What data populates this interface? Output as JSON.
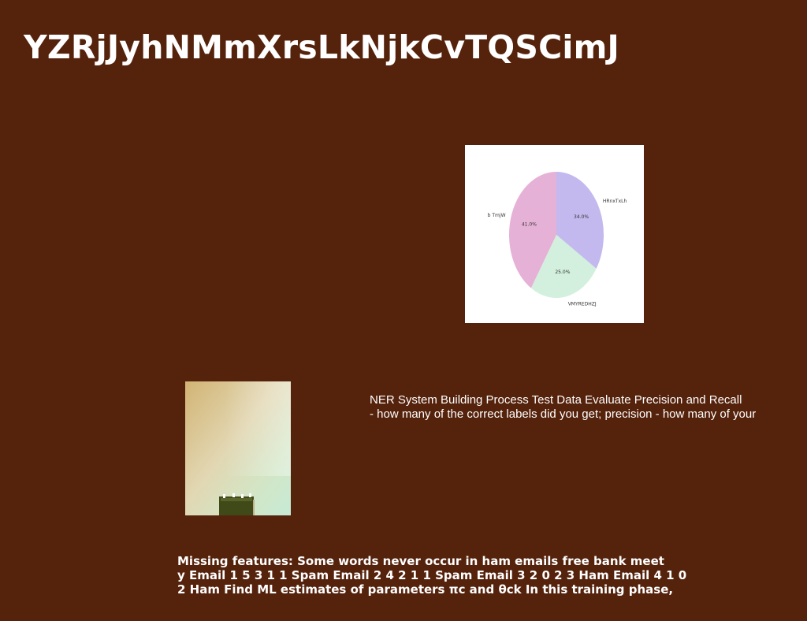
{
  "page": {
    "title": "YZRjJyhNMmXrsLkNjkCvTQSCimJ",
    "background_color": "#55220c"
  },
  "chart_data": {
    "type": "pie",
    "title": "",
    "slices": [
      {
        "label": "HRnxTxLh",
        "value": 34.0,
        "value_label": "34.0%",
        "color": "#c3b9ee"
      },
      {
        "label": "VMYREDHZJ",
        "value": 25.0,
        "value_label": "25.0%",
        "color": "#d2f0dd"
      },
      {
        "label": "b TmjW",
        "value": 41.0,
        "value_label": "41.0%",
        "color": "#e6b1d6"
      }
    ]
  },
  "photo": {
    "description_icon": "photo-image"
  },
  "side_text": {
    "line1": "NER System Building Process Test Data Evaluate Precision and Recall",
    "line2": "- how many of the correct labels did you get; precision - how many of your"
  },
  "bottom_text": {
    "line1": "Missing features: Some words never occur in ham emails free bank meet",
    "line2": "y Email 1 5 3 1 1 Spam Email 2 4 2 1 1 Spam Email 3 2 0 2 3 Ham Email 4 1 0",
    "line3": "2 Ham Find ML estimates of parameters πc and θck In this training phase,"
  }
}
